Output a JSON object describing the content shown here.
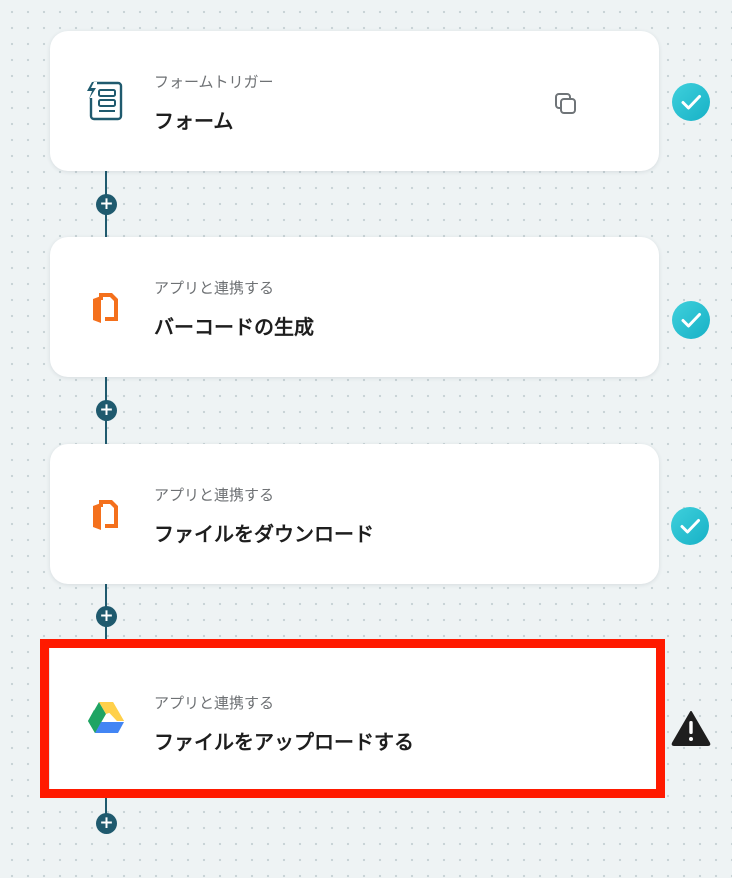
{
  "steps": [
    {
      "subtitle": "フォームトリガー",
      "title": "フォーム",
      "icon": "form-trigger-icon",
      "status": "completed"
    },
    {
      "subtitle": "アプリと連携する",
      "title": "バーコードの生成",
      "icon": "document-app-icon",
      "status": "completed"
    },
    {
      "subtitle": "アプリと連携する",
      "title": "ファイルをダウンロード",
      "icon": "document-app-icon",
      "status": "completed"
    },
    {
      "subtitle": "アプリと連携する",
      "title": "ファイルをアップロードする",
      "icon": "google-drive-icon",
      "status": "warning"
    }
  ],
  "add_step_symbol": "+",
  "colors": {
    "connector": "#1f5a6e",
    "check": "#1fbcd0",
    "highlight": "#ff1a00",
    "document_app_orange": "#f4701c"
  }
}
